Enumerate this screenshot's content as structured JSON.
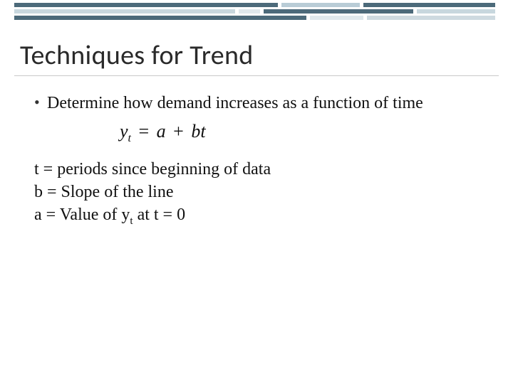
{
  "title": "Techniques for Trend",
  "bullet1": "Determine how demand increases as a function of time",
  "equation": {
    "lhs_var": "y",
    "lhs_sub": "t",
    "eq": "=",
    "rhs_a": "a",
    "plus": "+",
    "rhs_b": "b",
    "rhs_t": "t"
  },
  "defs": {
    "line1": "t = periods since beginning of data",
    "line2": "b = Slope of the line",
    "line3_pre": "a = Value of y",
    "line3_sub": "t",
    "line3_post": " at t = 0"
  }
}
